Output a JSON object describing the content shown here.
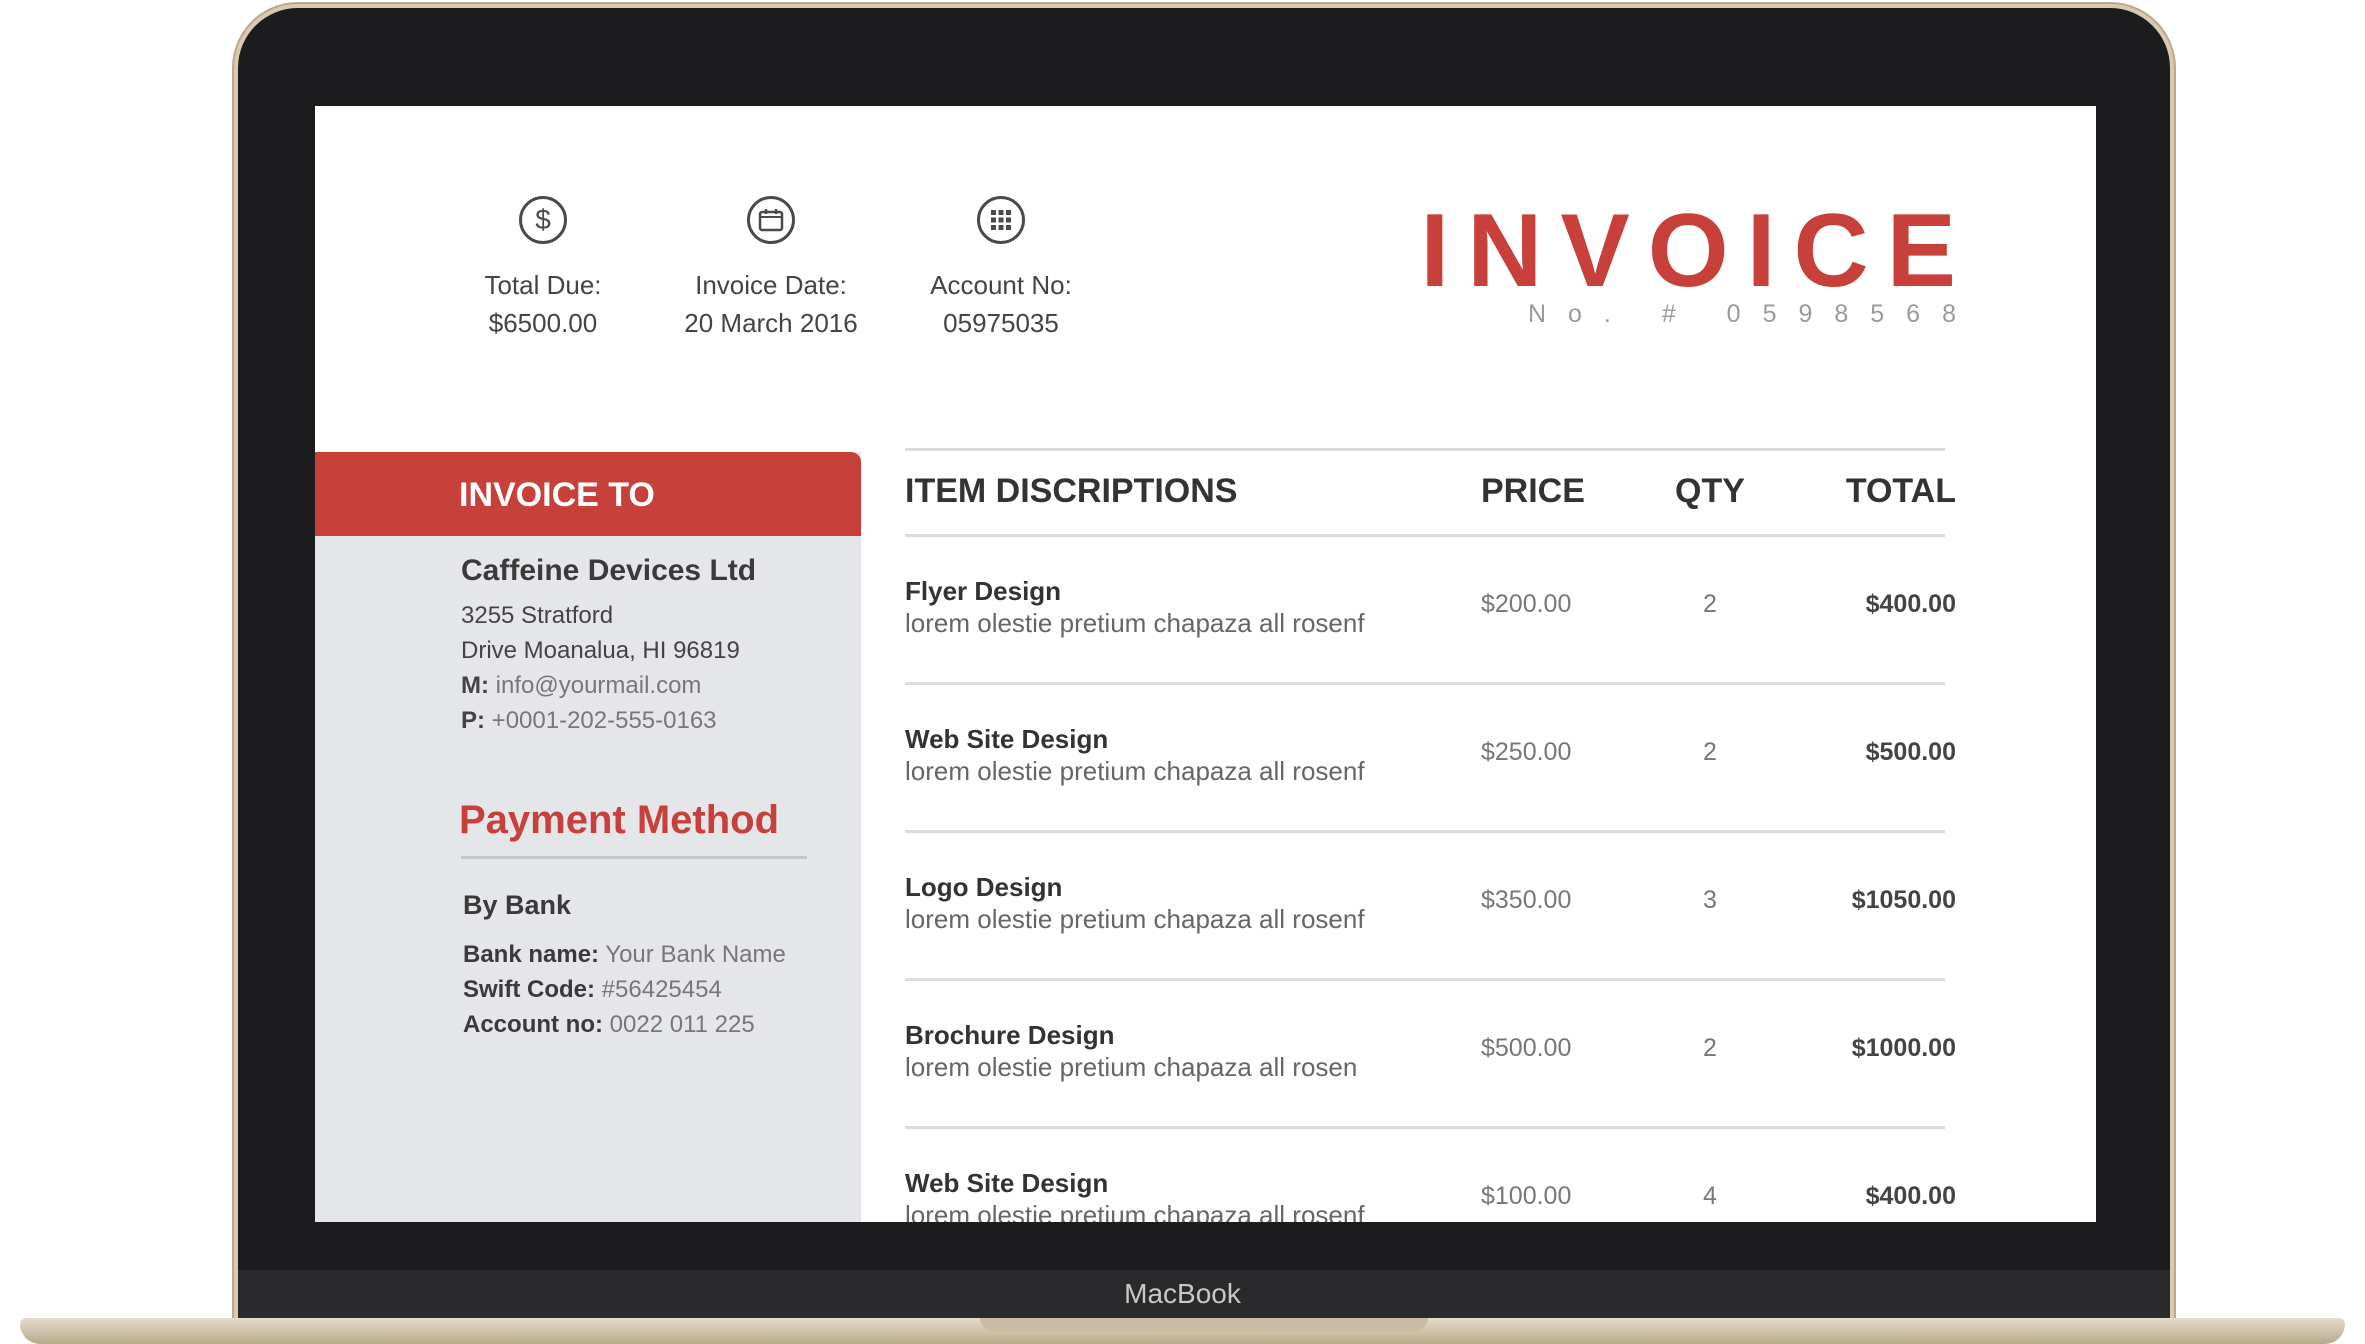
{
  "device": {
    "brand": "MacBook"
  },
  "invoice": {
    "title": "INVOICE",
    "number": "No. # 0598568"
  },
  "summary": [
    {
      "icon": "dollar-icon",
      "label": "Total Due:",
      "value": "$6500.00"
    },
    {
      "icon": "calendar-icon",
      "label": "Invoice Date:",
      "value": "20 March 2016"
    },
    {
      "icon": "keypad-icon",
      "label": "Account No:",
      "value": "05975035"
    }
  ],
  "invoice_to": {
    "header": "INVOICE TO",
    "company": "Caffeine Devices Ltd",
    "address_line1": "3255 Stratford",
    "address_line2": "Drive Moanalua, HI 96819",
    "mail_label": "M:",
    "mail_value": "info@yourmail.com",
    "phone_label": "P:",
    "phone_value": "+0001-202-555-0163"
  },
  "payment": {
    "title": "Payment Method",
    "method": "By Bank",
    "bank_label": "Bank name:",
    "bank_value": "Your Bank Name",
    "swift_label": "Swift Code:",
    "swift_value": "#56425454",
    "account_label": "Account no:",
    "account_value": "0022 011 225"
  },
  "table": {
    "headers": {
      "description": "ITEM DISCRIPTIONS",
      "price": "PRICE",
      "qty": "QTY",
      "total": "TOTAL"
    },
    "rows": [
      {
        "title": "Flyer Design",
        "desc": "lorem olestie pretium chapaza all rosenf",
        "price": "$200.00",
        "qty": "2",
        "total": "$400.00"
      },
      {
        "title": "Web Site Design",
        "desc": "lorem olestie pretium chapaza all rosenf",
        "price": "$250.00",
        "qty": "2",
        "total": "$500.00"
      },
      {
        "title": "Logo Design",
        "desc": "lorem olestie pretium chapaza all rosenf",
        "price": "$350.00",
        "qty": "3",
        "total": "$1050.00"
      },
      {
        "title": "Brochure Design",
        "desc": "lorem olestie pretium chapaza all rosen",
        "price": "$500.00",
        "qty": "2",
        "total": "$1000.00"
      },
      {
        "title": "Web Site Design",
        "desc": "lorem olestie pretium chapaza all rosenf",
        "price": "$100.00",
        "qty": "4",
        "total": "$400.00"
      }
    ]
  },
  "colors": {
    "accent": "#c8403a",
    "panel": "#e4e6ea"
  }
}
